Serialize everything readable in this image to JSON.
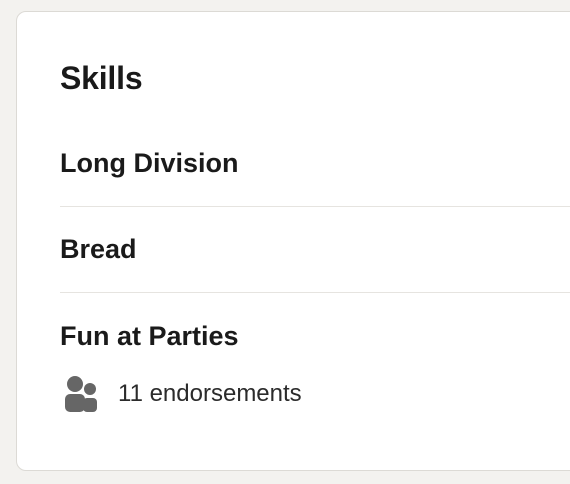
{
  "skills_card": {
    "title": "Skills",
    "skills": [
      {
        "name": "Long Division"
      },
      {
        "name": "Bread"
      },
      {
        "name": "Fun at Parties",
        "endorsements": "11 endorsements",
        "icon": "people-icon"
      }
    ]
  }
}
